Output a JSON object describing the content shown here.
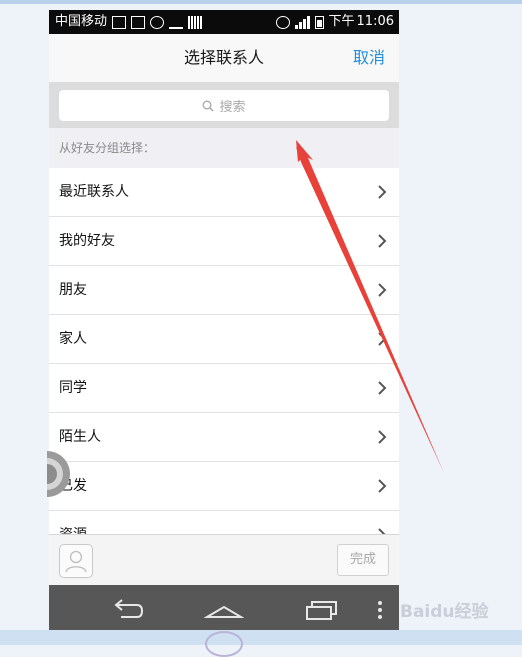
{
  "status_bar": {
    "carrier": "中国移动",
    "time_prefix": "下午",
    "time": "11:06",
    "signal_level": 4,
    "battery_level": 0.6
  },
  "header": {
    "title": "选择联系人",
    "cancel_label": "取消"
  },
  "search": {
    "placeholder": "搜索",
    "icon": "search-icon"
  },
  "section": {
    "label": "从好友分组选择："
  },
  "groups": [
    {
      "label": "最近联系人"
    },
    {
      "label": "我的好友"
    },
    {
      "label": "朋友"
    },
    {
      "label": "家人"
    },
    {
      "label": "同学"
    },
    {
      "label": "陌生人"
    },
    {
      "label": "已发"
    },
    {
      "label": "资源"
    }
  ],
  "footer": {
    "done_label": "完成",
    "avatar_icon": "person-icon"
  },
  "nav": {
    "icons": [
      "back-icon",
      "home-icon",
      "recent-apps-icon",
      "menu-icon"
    ]
  },
  "watermark": {
    "text": "Baidu经验"
  },
  "colors": {
    "accent": "#1e8fdc",
    "annotation_arrow": "#e8413a",
    "status_bar": "#0b0b0b",
    "nav_bar": "#575757"
  }
}
